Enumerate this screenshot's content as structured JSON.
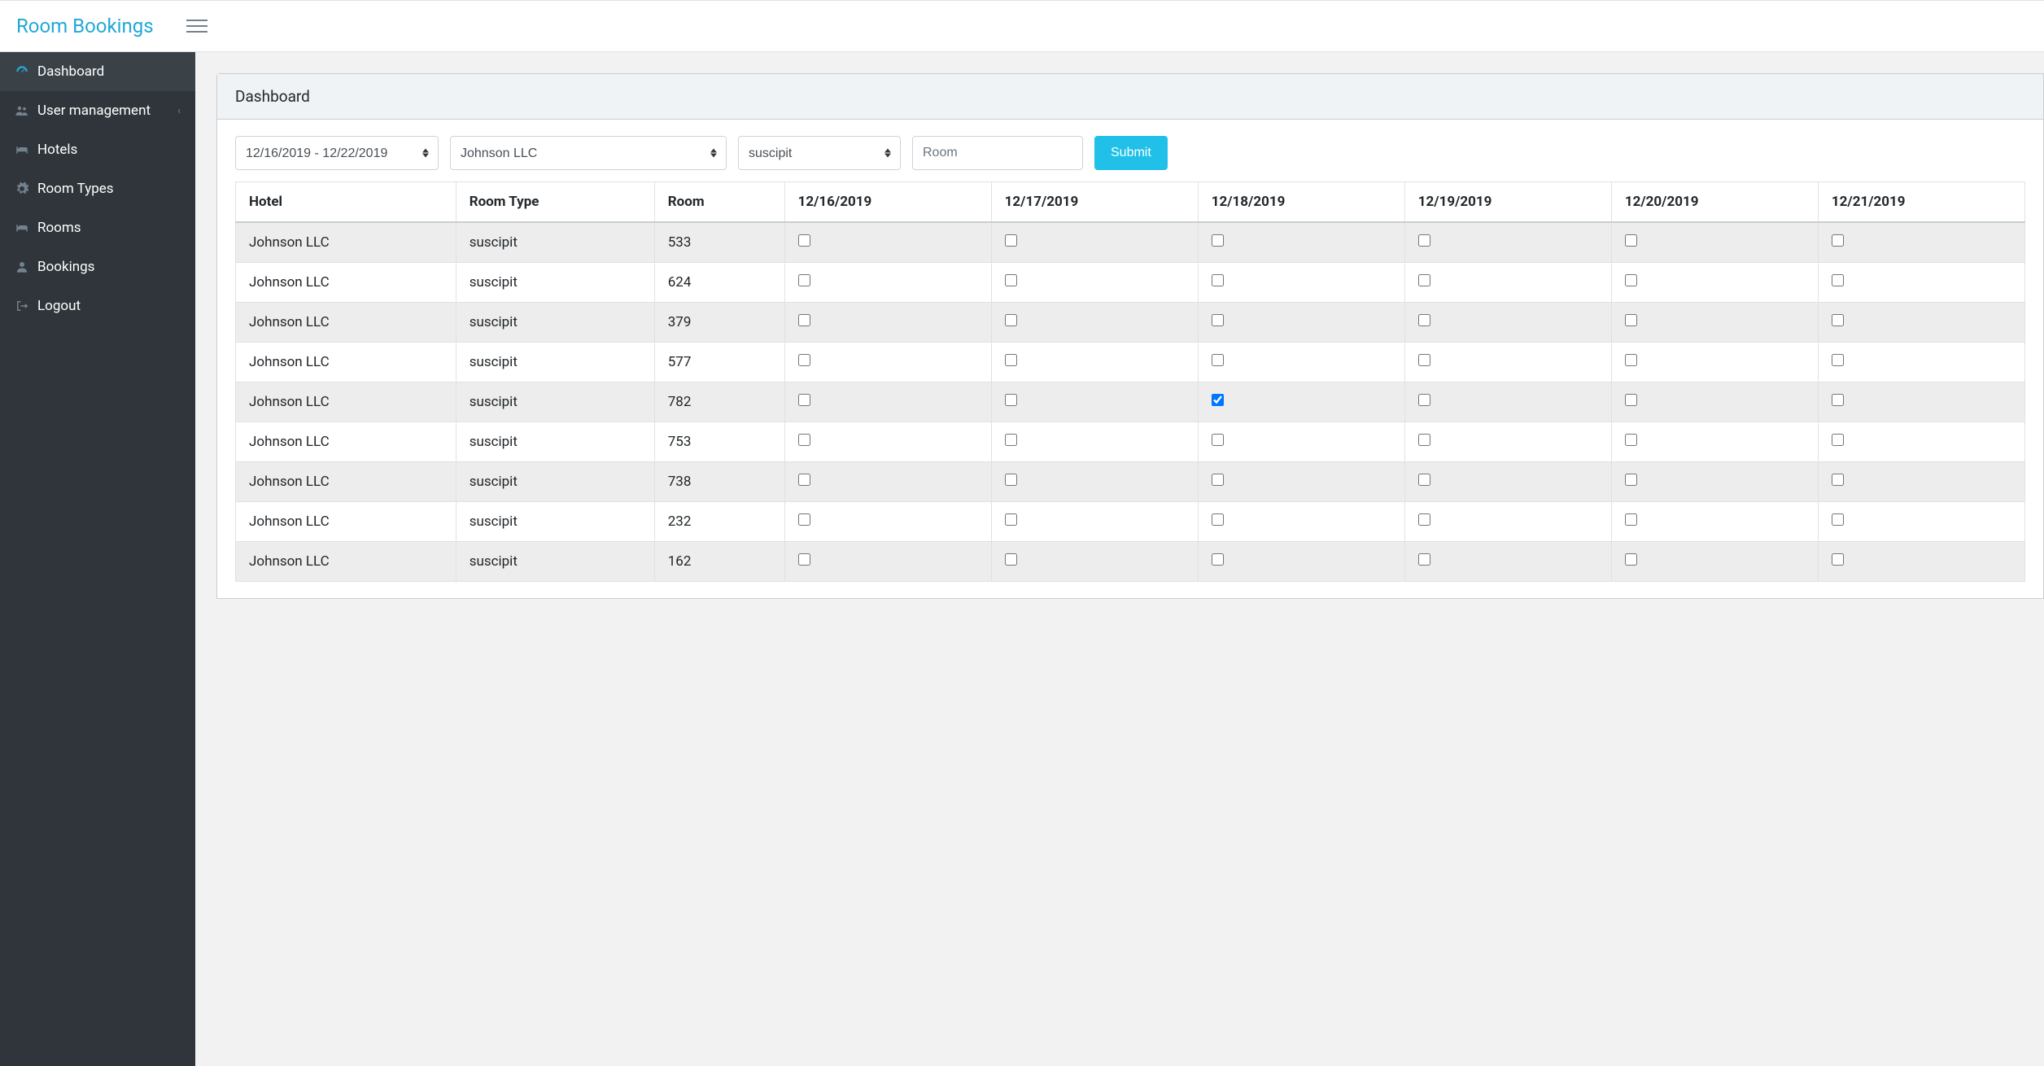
{
  "app": {
    "brand": "Room Bookings"
  },
  "sidebar": {
    "items": [
      {
        "label": "Dashboard",
        "icon": "dashboard-icon",
        "active": true
      },
      {
        "label": "User management",
        "icon": "users-icon",
        "has_children": true
      },
      {
        "label": "Hotels",
        "icon": "bed-icon"
      },
      {
        "label": "Room Types",
        "icon": "gears-icon"
      },
      {
        "label": "Rooms",
        "icon": "bed-icon"
      },
      {
        "label": "Bookings",
        "icon": "user-icon"
      },
      {
        "label": "Logout",
        "icon": "logout-icon"
      }
    ]
  },
  "page": {
    "title": "Dashboard"
  },
  "filters": {
    "date_range": "12/16/2019 - 12/22/2019",
    "hotel": "Johnson LLC",
    "room_type": "suscipit",
    "room_placeholder": "Room",
    "submit_label": "Submit"
  },
  "table": {
    "headers": [
      "Hotel",
      "Room Type",
      "Room",
      "12/16/2019",
      "12/17/2019",
      "12/18/2019",
      "12/19/2019",
      "12/20/2019",
      "12/21/2019"
    ],
    "rows": [
      {
        "hotel": "Johnson LLC",
        "room_type": "suscipit",
        "room": "533",
        "checks": [
          false,
          false,
          false,
          false,
          false,
          false
        ]
      },
      {
        "hotel": "Johnson LLC",
        "room_type": "suscipit",
        "room": "624",
        "checks": [
          false,
          false,
          false,
          false,
          false,
          false
        ]
      },
      {
        "hotel": "Johnson LLC",
        "room_type": "suscipit",
        "room": "379",
        "checks": [
          false,
          false,
          false,
          false,
          false,
          false
        ]
      },
      {
        "hotel": "Johnson LLC",
        "room_type": "suscipit",
        "room": "577",
        "checks": [
          false,
          false,
          false,
          false,
          false,
          false
        ]
      },
      {
        "hotel": "Johnson LLC",
        "room_type": "suscipit",
        "room": "782",
        "checks": [
          false,
          false,
          true,
          false,
          false,
          false
        ]
      },
      {
        "hotel": "Johnson LLC",
        "room_type": "suscipit",
        "room": "753",
        "checks": [
          false,
          false,
          false,
          false,
          false,
          false
        ]
      },
      {
        "hotel": "Johnson LLC",
        "room_type": "suscipit",
        "room": "738",
        "checks": [
          false,
          false,
          false,
          false,
          false,
          false
        ]
      },
      {
        "hotel": "Johnson LLC",
        "room_type": "suscipit",
        "room": "232",
        "checks": [
          false,
          false,
          false,
          false,
          false,
          false
        ]
      },
      {
        "hotel": "Johnson LLC",
        "room_type": "suscipit",
        "room": "162",
        "checks": [
          false,
          false,
          false,
          false,
          false,
          false
        ]
      }
    ]
  }
}
